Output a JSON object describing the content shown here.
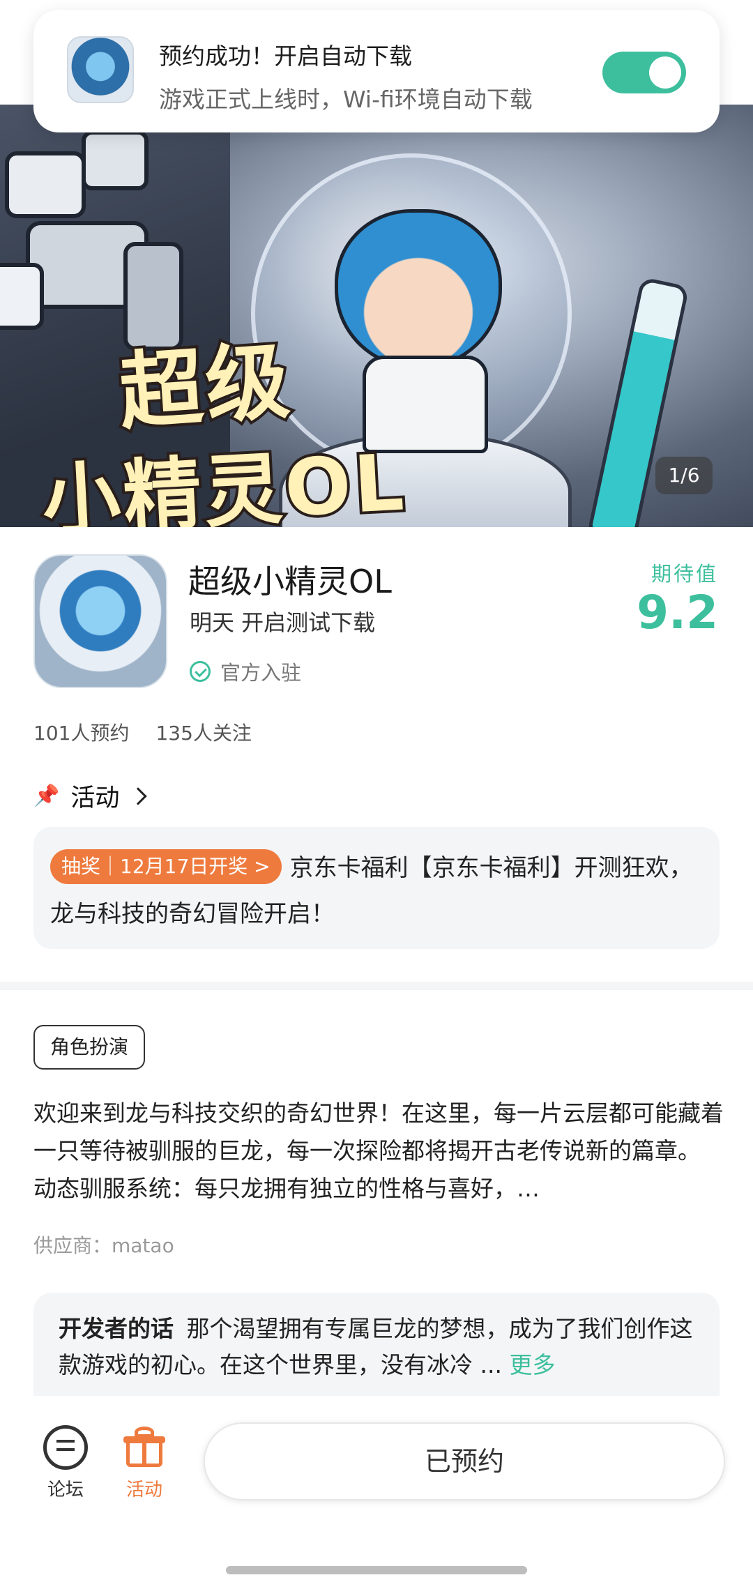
{
  "toast": {
    "title": "预约成功！开启自动下载",
    "subtitle": "游戏正式上线时，Wi-fi环境自动下载",
    "switch_on": true,
    "switch_color": "#3dbf9d"
  },
  "banner": {
    "title_line1": "超级",
    "title_line2": "小精灵OL",
    "counter": "1/6"
  },
  "app": {
    "name": "超级小精灵OL",
    "schedule": "明天 开启测试下载",
    "official": "官方入驻",
    "expect_label": "期待值",
    "expect_score": "9.2",
    "accent_color": "#3dbf9d"
  },
  "stats": {
    "reservations": "101人预约",
    "followers": "135人关注"
  },
  "activity": {
    "heading": "活动",
    "tag": "抽奖｜12月17日开奖 >",
    "text": "京东卡福利【京东卡福利】开测狂欢，龙与科技的奇幻冒险开启！",
    "tag_color": "#ee7a3d"
  },
  "genre": "角色扮演",
  "description": "欢迎来到龙与科技交织的奇幻世界！在这里，每一片云层都可能藏着一只等待被驯服的巨龙，每一次探险都将揭开古老传说新的篇章。 动态驯服系统：每只龙拥有独立的性格与喜好，…",
  "supplier": "供应商：matao",
  "developer": {
    "label": "开发者的话",
    "text": "那个渴望拥有专属巨龙的梦想，成为了我们创作这款游戏的初心。在这个世界里，没有冰冷 ...",
    "more": "更多"
  },
  "bottom_bar": {
    "forum": "论坛",
    "activity": "活动",
    "reserved": "已预约"
  }
}
